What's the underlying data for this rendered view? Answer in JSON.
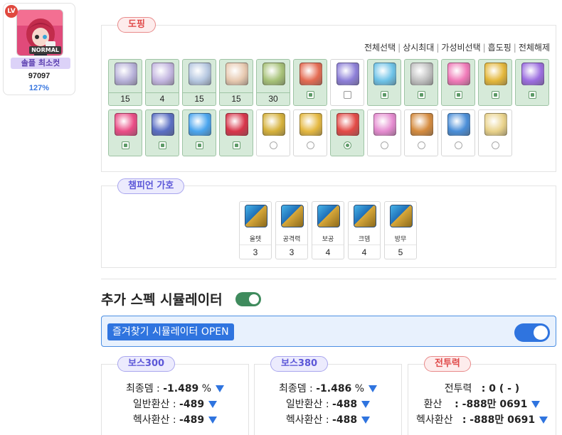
{
  "character": {
    "level_badge": "LV",
    "avatar_badge": "NORMAL",
    "name": "솔플 최소컷",
    "number": "97097",
    "percent": "127%"
  },
  "doping": {
    "title": "도핑",
    "links": [
      "전체선택",
      "상시최대",
      "가성비선택",
      "흡도핑",
      "전체해제"
    ],
    "items": [
      {
        "icon": "exp-coupon-icon",
        "color": "#b7b1d9",
        "count": "15",
        "active": true,
        "control": "count"
      },
      {
        "icon": "exp-coupon-icon",
        "color": "#c3b6e0",
        "count": "4",
        "active": true,
        "control": "count"
      },
      {
        "icon": "exp-coupon-icon",
        "color": "#b5c7e0",
        "count": "15",
        "active": true,
        "control": "count"
      },
      {
        "icon": "potion-explosion-icon",
        "color": "#e7c9b0",
        "count": "15",
        "active": true,
        "control": "count"
      },
      {
        "icon": "scroll-icon",
        "color": "#a7c278",
        "count": "30",
        "active": true,
        "control": "count"
      },
      {
        "icon": "red-orb-icon",
        "color": "#e46b52",
        "active": true,
        "control": "checkbox",
        "checked": true
      },
      {
        "icon": "purple-pill-icon",
        "color": "#8d7fd8",
        "active": false,
        "control": "checkbox",
        "checked": false
      },
      {
        "icon": "blue-275-icon",
        "color": "#6ec3e8",
        "active": true,
        "control": "checkbox",
        "checked": true
      },
      {
        "icon": "silver-ring-icon",
        "color": "#c0c0c0",
        "active": true,
        "control": "checkbox",
        "checked": true
      },
      {
        "icon": "pink-union-icon",
        "color": "#f07ab8",
        "active": true,
        "control": "checkbox",
        "checked": true
      },
      {
        "icon": "gold-box-icon",
        "color": "#e4b73a",
        "active": true,
        "control": "checkbox",
        "checked": true
      },
      {
        "icon": "gift-box-icon",
        "color": "#9c6ee0",
        "active": true,
        "control": "checkbox",
        "checked": true
      },
      {
        "icon": "pink-potion-icon",
        "color": "#ea4d86",
        "active": true,
        "control": "checkbox",
        "checked": true
      },
      {
        "icon": "elixir-flask-icon",
        "color": "#5a6fc4",
        "active": true,
        "control": "checkbox",
        "checked": true
      },
      {
        "icon": "mvp-icon",
        "color": "#4aa5ee",
        "active": true,
        "control": "checkbox",
        "checked": true
      },
      {
        "icon": "vip-icon",
        "color": "#d8354a",
        "active": true,
        "control": "checkbox",
        "checked": true
      },
      {
        "icon": "gold-leaf-icon",
        "color": "#d6b13a",
        "active": false,
        "control": "radio",
        "checked": false
      },
      {
        "icon": "gold-sword-icon",
        "color": "#e5b840",
        "active": false,
        "control": "radio",
        "checked": false
      },
      {
        "icon": "red-cross-icon",
        "color": "#e34a46",
        "active": true,
        "control": "radio",
        "checked": true
      },
      {
        "icon": "candy-icon",
        "color": "#e58bd0",
        "active": false,
        "control": "radio",
        "checked": false
      },
      {
        "icon": "fish-bread-icon",
        "color": "#d58b3e",
        "active": false,
        "control": "radio",
        "checked": false
      },
      {
        "icon": "sake-bottle-icon",
        "color": "#4a8ed8",
        "active": false,
        "control": "radio",
        "checked": false
      },
      {
        "icon": "milk-bottle-icon",
        "color": "#e9d28a",
        "active": false,
        "control": "radio",
        "checked": false
      }
    ]
  },
  "champion": {
    "title": "챔피언 가호",
    "items": [
      {
        "label": "올텟",
        "value": "3"
      },
      {
        "label": "공격력",
        "value": "3"
      },
      {
        "label": "보공",
        "value": "4"
      },
      {
        "label": "크뎀",
        "value": "4"
      },
      {
        "label": "방무",
        "value": "5"
      }
    ]
  },
  "simulator": {
    "title": "추가 스펙 시뮬레이터",
    "fav_button": "즐겨찾기 시뮬레이터 OPEN"
  },
  "stats": {
    "boss300": {
      "title": "보스300",
      "final_dmg_label": "최종뎀 :",
      "final_dmg_value": "-1.489",
      "final_dmg_unit": "%",
      "general_label": "일반환산 :",
      "general_value": "-489",
      "hexa_label": "헥사환산 :",
      "hexa_value": "-489"
    },
    "boss380": {
      "title": "보스380",
      "final_dmg_label": "최종뎀 :",
      "final_dmg_value": "-1.486",
      "final_dmg_unit": "%",
      "general_label": "일반환산 :",
      "general_value": "-488",
      "hexa_label": "헥사환산 :",
      "hexa_value": "-488"
    },
    "power": {
      "title": "전투력",
      "cp_label": "전투력",
      "cp_value": ": 0 ( - )",
      "conv_label": "환산",
      "conv_value": ": -888만 0691",
      "hexa_label": "헥사환산",
      "hexa_value": ": -888만 0691"
    }
  }
}
